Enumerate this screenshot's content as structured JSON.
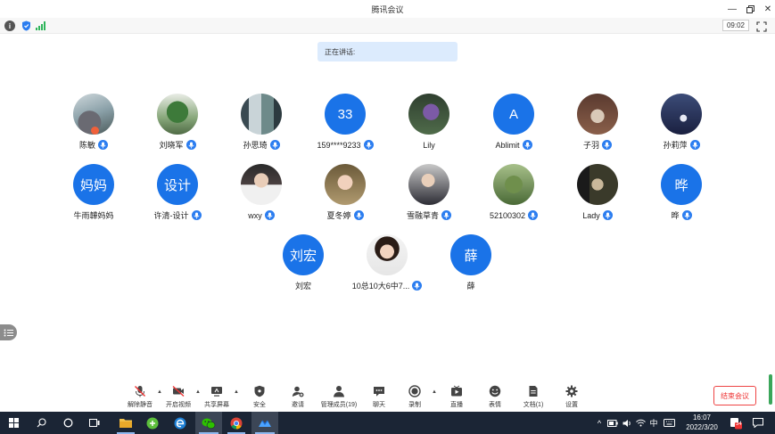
{
  "window": {
    "title": "腾讯会议"
  },
  "infobar": {
    "timer": "09:02"
  },
  "speaking": {
    "label": "正在讲话:"
  },
  "participants": [
    {
      "name": "陈敏",
      "avatar": "photo",
      "mic": true
    },
    {
      "name": "刘晓军",
      "avatar": "photo",
      "mic": true
    },
    {
      "name": "孙思琦",
      "avatar": "photo",
      "mic": true
    },
    {
      "name": "159****9233",
      "avatar": "text",
      "initials": "33",
      "mic": true
    },
    {
      "name": "Lily",
      "avatar": "photo",
      "mic": false
    },
    {
      "name": "Ablimit",
      "avatar": "text",
      "initials": "A",
      "mic": true
    },
    {
      "name": "子羽",
      "avatar": "photo",
      "mic": true
    },
    {
      "name": "孙莉萍",
      "avatar": "photo",
      "mic": true
    },
    {
      "name": "牛雨韡妈妈",
      "avatar": "text",
      "initials": "妈妈",
      "mic": false
    },
    {
      "name": "许清-设计",
      "avatar": "text",
      "initials": "设计",
      "mic": true
    },
    {
      "name": "wxy",
      "avatar": "photo",
      "mic": true
    },
    {
      "name": "夏冬婷",
      "avatar": "photo",
      "mic": true
    },
    {
      "name": "雪融草青",
      "avatar": "photo",
      "mic": true
    },
    {
      "name": "52100302",
      "avatar": "photo",
      "mic": true
    },
    {
      "name": "Lady",
      "avatar": "photo",
      "mic": true
    },
    {
      "name": "晔",
      "avatar": "text",
      "initials": "晔",
      "mic": true
    },
    {
      "name": "刘宏",
      "avatar": "text",
      "initials": "刘宏",
      "mic": false
    },
    {
      "name": "10总10大6中7...",
      "avatar": "photo",
      "mic": true
    },
    {
      "name": "薛",
      "avatar": "text",
      "initials": "薛",
      "mic": false
    }
  ],
  "toolbar": {
    "unmute": "解除静音",
    "video": "开启视频",
    "share": "共享屏幕",
    "security": "安全",
    "invite": "邀请",
    "members": "管理成员(19)",
    "chat": "聊天",
    "record": "录制",
    "live": "直播",
    "emoji": "表情",
    "docs": "文档(1)",
    "settings": "设置",
    "end_meeting": "结束会议"
  },
  "taskbar": {
    "ime": "中",
    "time": "16:07",
    "date": "2022/3/20",
    "notification_count": "34"
  },
  "colors": {
    "accent": "#1a73e8",
    "end_red": "#e33333",
    "taskbar": "#1b2535"
  }
}
